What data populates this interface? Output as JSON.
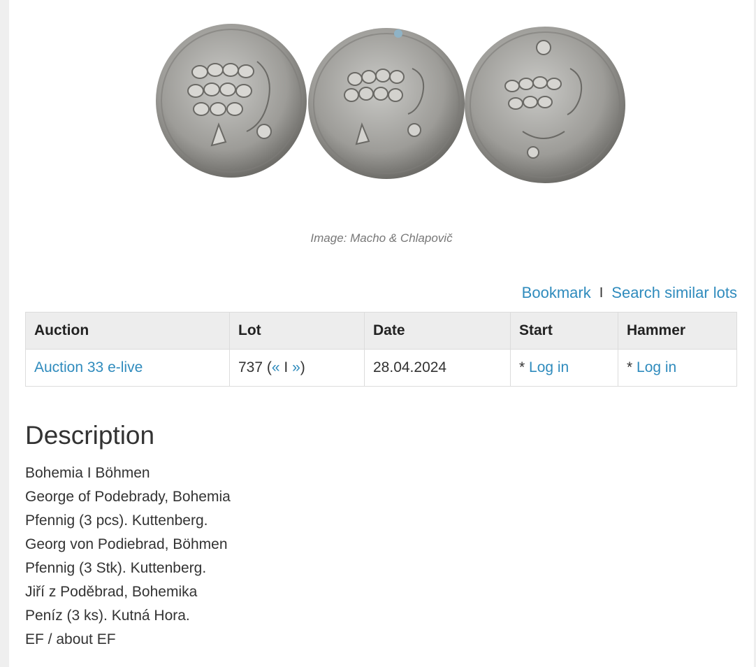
{
  "image_caption": "Image: Macho & Chlapovič",
  "actions": {
    "bookmark": "Bookmark",
    "separator": "I",
    "search_similar": "Search similar lots"
  },
  "table": {
    "headers": [
      "Auction",
      "Lot",
      "Date",
      "Start",
      "Hammer"
    ],
    "row": {
      "auction": "Auction 33 e-live",
      "lot_number": "737",
      "lot_open": "(",
      "prev": "«",
      "lot_sep": "I",
      "next": "»",
      "lot_close": ")",
      "date": "28.04.2024",
      "start_prefix": "* ",
      "start_link": "Log in",
      "hammer_prefix": "* ",
      "hammer_link": "Log in"
    }
  },
  "description": {
    "title": "Description",
    "lines": [
      "Bohemia I Böhmen",
      "George of Podebrady, Bohemia",
      "Pfennig (3 pcs). Kuttenberg.",
      "Georg von Podiebrad, Böhmen",
      "Pfennig (3 Stk). Kuttenberg.",
      "Jiří z Poděbrad, Bohemika",
      "Peníz (3 ks). Kutná Hora.",
      "EF / about EF"
    ]
  },
  "colors": {
    "link": "#2f8bbd",
    "header_bg": "#ededed",
    "page_bg": "#efefef"
  },
  "icons": [
    "coin-image"
  ]
}
